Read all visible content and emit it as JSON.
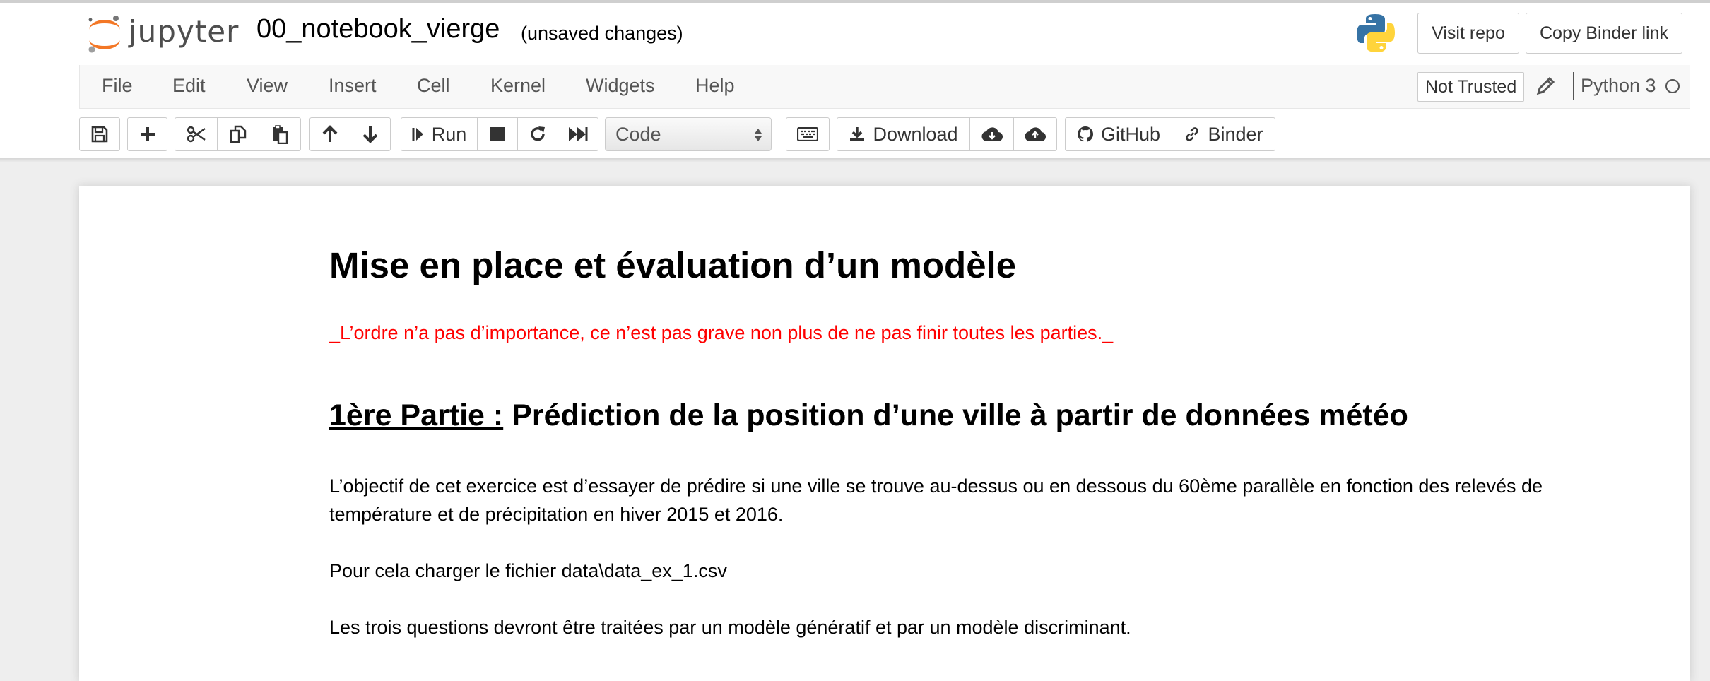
{
  "header": {
    "logo_text": "jupyter",
    "notebook_name": "00_notebook_vierge",
    "save_status": "(unsaved changes)",
    "visit_repo_label": "Visit repo",
    "copy_binder_label": "Copy Binder link"
  },
  "menubar": {
    "items": [
      "File",
      "Edit",
      "View",
      "Insert",
      "Cell",
      "Kernel",
      "Widgets",
      "Help"
    ],
    "trust_label": "Not Trusted",
    "kernel_name": "Python 3"
  },
  "toolbar": {
    "run_label": "Run",
    "cell_type": "Code",
    "download_label": "Download",
    "github_label": "GitHub",
    "binder_label": "Binder"
  },
  "notebook": {
    "title": "Mise en place et évaluation d’un modèle",
    "note": "_L’ordre n’a pas d’importance, ce n’est pas grave non plus de ne pas finir toutes les parties._",
    "part_label": "1ère Partie :",
    "part_title": " Prédiction de la position d’une ville à partir de données météo",
    "paragraph1": "L’objectif de cet exercice est d’essayer de prédire si une ville se trouve au-dessus ou en dessous du 60ème parallèle en fonction des relevés de température et de précipitation en hiver 2015 et 2016.",
    "paragraph2": "Pour cela charger le fichier data\\data_ex_1.csv",
    "paragraph3": "Les trois questions devront être traitées par un modèle génératif et par un modèle discriminant."
  },
  "colors": {
    "jupyter_orange": "#f37726",
    "note_red": "#ff0000",
    "python_blue": "#3673a5",
    "python_yellow": "#ffd43b"
  },
  "icons": [
    "jupyter-logo",
    "python-logo",
    "pencil-icon",
    "save-icon",
    "plus-icon",
    "cut-icon",
    "copy-icon",
    "paste-icon",
    "arrow-up-icon",
    "arrow-down-icon",
    "step-forward-icon",
    "stop-icon",
    "refresh-icon",
    "fast-forward-icon",
    "keyboard-icon",
    "download-icon",
    "cloud-download-icon",
    "cloud-upload-icon",
    "github-icon",
    "link-icon"
  ]
}
